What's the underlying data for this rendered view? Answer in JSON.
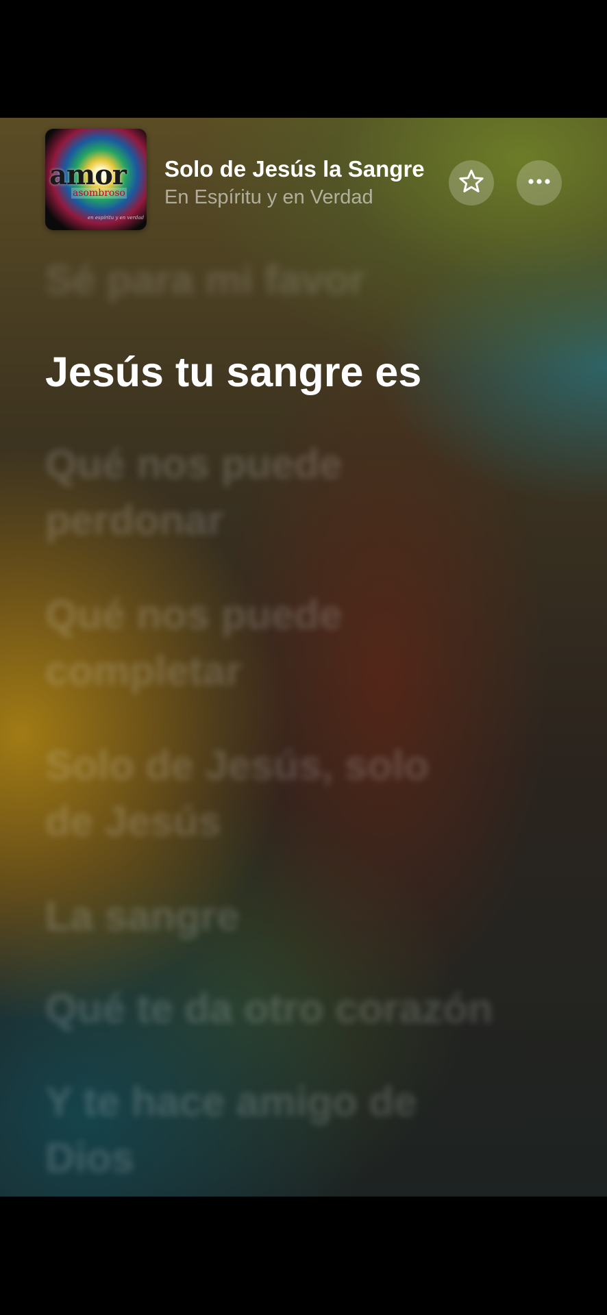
{
  "now_playing": {
    "title": "Solo de Jesús la Sangre",
    "artist": "En Espíritu y en Verdad",
    "artwork": {
      "main_word": "amor",
      "sub_word": "asombroso",
      "tiny_text": "en espíritu y en verdad"
    },
    "favorite_icon": "star-outline-icon",
    "more_icon": "ellipsis-icon"
  },
  "lyrics": [
    {
      "text": "Sé para mi favor",
      "state": "previous"
    },
    {
      "text": "Jesús tu sangre es",
      "state": "current"
    },
    {
      "text": "Qué nos puede perdonar",
      "state": "upcoming"
    },
    {
      "text": "Qué nos puede completar",
      "state": "upcoming"
    },
    {
      "text": "Solo de Jesús, solo de Jesús",
      "state": "upcoming"
    },
    {
      "text": "La sangre",
      "state": "upcoming"
    },
    {
      "text": "Qué te da otro corazón",
      "state": "upcoming"
    },
    {
      "text": "Y te hace amigo de Dios",
      "state": "upcoming"
    }
  ],
  "colors": {
    "current_lyric": "#ffffff",
    "dim_lyric": "rgba(255,255,255,0.18)",
    "button_bg": "rgba(255,255,255,0.22)"
  }
}
